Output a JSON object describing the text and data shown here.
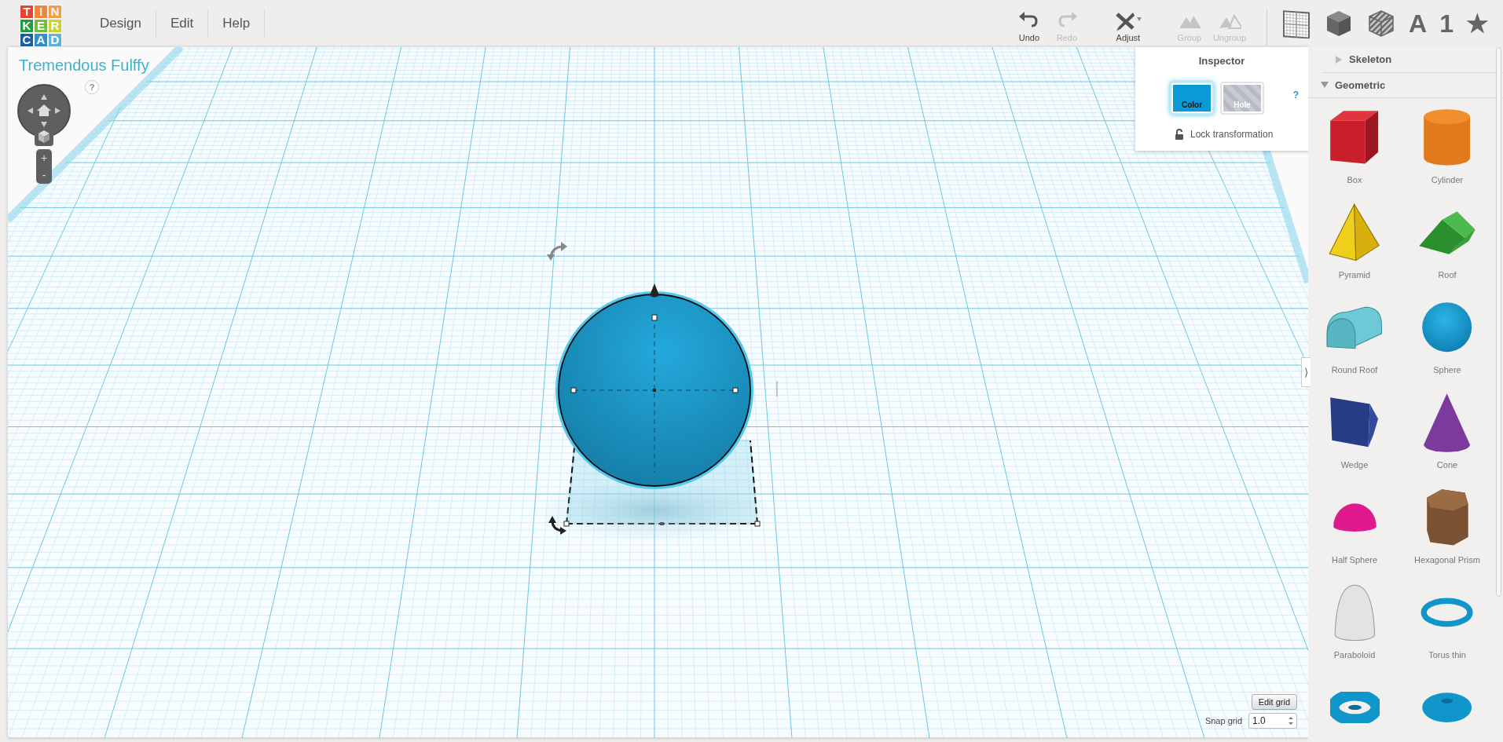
{
  "logo": {
    "tiles": [
      {
        "letter": "T",
        "color": "#e8432e"
      },
      {
        "letter": "I",
        "color": "#f5853a"
      },
      {
        "letter": "N",
        "color": "#f79b45"
      },
      {
        "letter": "K",
        "color": "#1f9e48"
      },
      {
        "letter": "E",
        "color": "#6ebf3e"
      },
      {
        "letter": "R",
        "color": "#c8d433"
      },
      {
        "letter": "C",
        "color": "#1b5ea6"
      },
      {
        "letter": "A",
        "color": "#3190cf"
      },
      {
        "letter": "D",
        "color": "#5cb5e0"
      }
    ]
  },
  "menu": [
    {
      "label": "Design"
    },
    {
      "label": "Edit"
    },
    {
      "label": "Help"
    }
  ],
  "toolbar": [
    {
      "label": "Undo",
      "kind": "undo",
      "disabled": false
    },
    {
      "label": "Redo",
      "kind": "redo",
      "disabled": true
    },
    {
      "label": "Adjust",
      "kind": "adjust",
      "disabled": false
    },
    {
      "label": "Group",
      "kind": "group",
      "disabled": true
    },
    {
      "label": "Ungroup",
      "kind": "ungroup",
      "disabled": true
    }
  ],
  "view_tools": [
    {
      "kind": "grid"
    },
    {
      "kind": "solid"
    },
    {
      "kind": "hole"
    },
    {
      "kind": "text",
      "label": "A"
    },
    {
      "kind": "text",
      "label": "1"
    },
    {
      "kind": "text",
      "label": "★"
    }
  ],
  "design": {
    "title": "Tremendous Fulffy"
  },
  "navigation": {
    "help": "?",
    "zoom_in": "+",
    "zoom_out": "-"
  },
  "inspector": {
    "title": "Inspector",
    "help": "?",
    "modes": [
      {
        "label": "Color",
        "kind": "color",
        "selected": true
      },
      {
        "label": "Hole",
        "kind": "hole",
        "selected": false
      }
    ],
    "lock": {
      "label": "Lock transformation",
      "locked": false
    }
  },
  "grid_controls": {
    "edit_button": "Edit grid",
    "snap_label": "Snap grid",
    "snap_value": "1.0"
  },
  "sidebar": {
    "toggle": "⟩",
    "sections": [
      {
        "label": "Skeleton",
        "expanded": false
      },
      {
        "label": "Geometric",
        "expanded": true,
        "shapes": [
          {
            "label": "Box",
            "kind": "box"
          },
          {
            "label": "Cylinder",
            "kind": "cylinder"
          },
          {
            "label": "Pyramid",
            "kind": "pyramid"
          },
          {
            "label": "Roof",
            "kind": "roof"
          },
          {
            "label": "Round Roof",
            "kind": "round_roof"
          },
          {
            "label": "Sphere",
            "kind": "sphere"
          },
          {
            "label": "Wedge",
            "kind": "wedge"
          },
          {
            "label": "Cone",
            "kind": "cone"
          },
          {
            "label": "Half Sphere",
            "kind": "half_sphere"
          },
          {
            "label": "Hexagonal Prism",
            "kind": "hex_prism"
          },
          {
            "label": "Paraboloid",
            "kind": "paraboloid"
          },
          {
            "label": "Torus thin",
            "kind": "torus_thin"
          },
          {
            "kind": "torus"
          },
          {
            "kind": "torus_fat"
          }
        ]
      }
    ]
  }
}
